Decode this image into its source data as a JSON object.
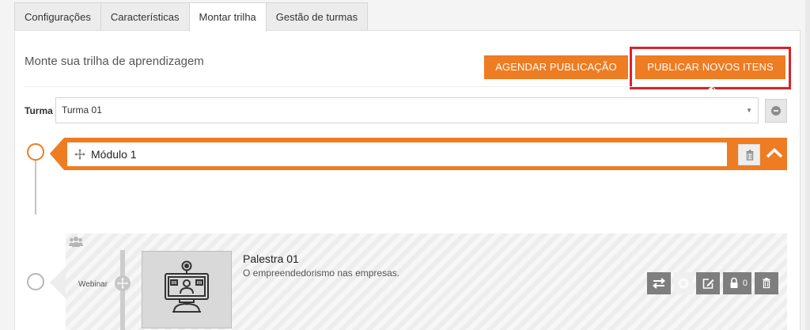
{
  "tabs": [
    {
      "label": "Configurações",
      "active": false
    },
    {
      "label": "Características",
      "active": false
    },
    {
      "label": "Montar trilha",
      "active": true
    },
    {
      "label": "Gestão de turmas",
      "active": false
    }
  ],
  "header": {
    "title": "Monte sua trilha de aprendizagem",
    "agendar_label": "AGENDAR PUBLICAÇÃO",
    "publicar_label": "PUBLICAR NOVOS ITENS"
  },
  "turma": {
    "label": "Turma",
    "value": "Turma 01"
  },
  "module": {
    "name": "Módulo 1"
  },
  "item": {
    "type_label": "Webinar",
    "title": "Palestra 01",
    "description": "O empreendedorismo nas empresas.",
    "lock_count": "0"
  },
  "colors": {
    "accent": "#ee7c22",
    "highlight": "#d9232e",
    "action_grey": "#7e7e7e"
  },
  "icons": [
    "clock-icon",
    "arrow-up-circle-icon",
    "minus-circle-icon",
    "move-icon",
    "trash-icon",
    "chevron-up-icon",
    "group-icon",
    "swap-icon",
    "gear-icon",
    "edit-icon",
    "lock-icon",
    "webinar-icon"
  ]
}
